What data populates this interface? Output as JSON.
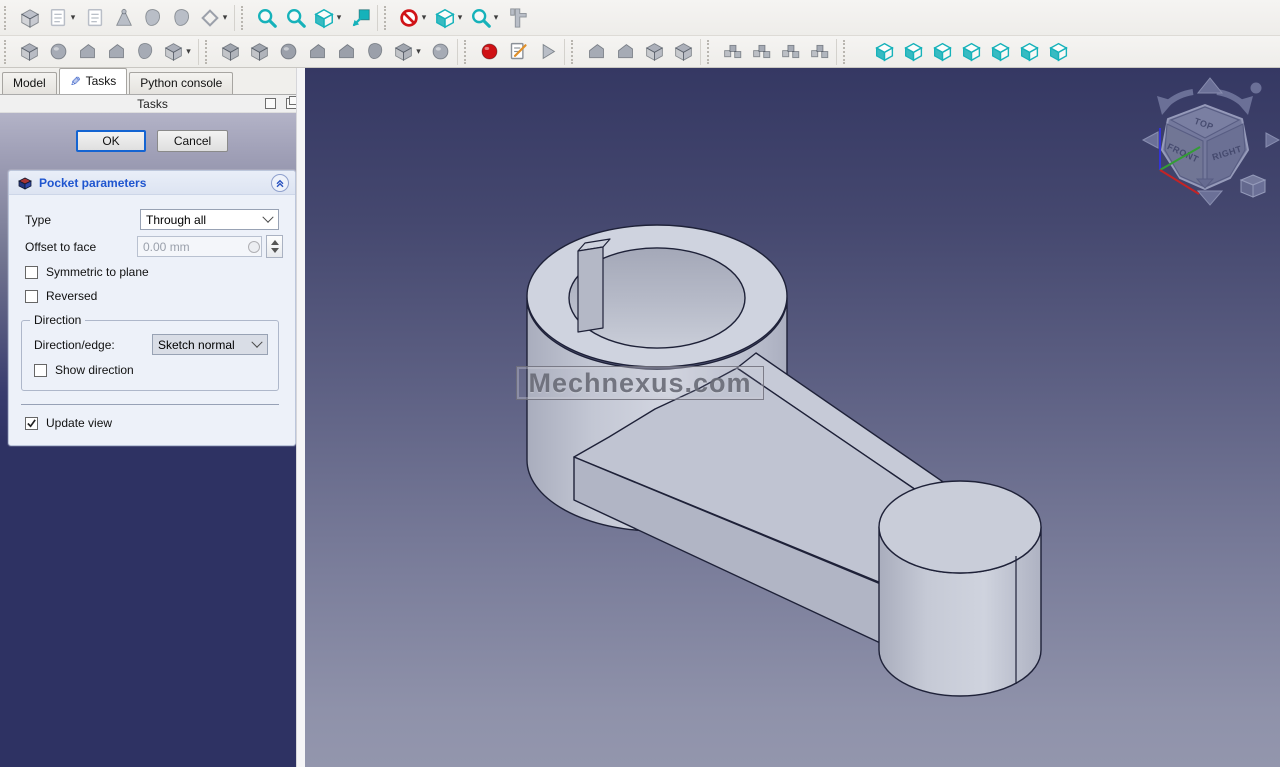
{
  "tabs": {
    "model": "Model",
    "tasks": "Tasks",
    "python": "Python console"
  },
  "tasks_header": {
    "title": "Tasks"
  },
  "dialog": {
    "ok": "OK",
    "cancel": "Cancel"
  },
  "pocket": {
    "title": "Pocket parameters",
    "type_label": "Type",
    "type_value": "Through all",
    "offset_label": "Offset to face",
    "offset_value": "0.00 mm",
    "symmetric_label": "Symmetric to plane",
    "reversed_label": "Reversed",
    "direction": {
      "legend": "Direction",
      "edge_label": "Direction/edge:",
      "edge_value": "Sketch normal",
      "show_label": "Show direction"
    },
    "update_view": "Update view"
  },
  "viewport": {
    "watermark": "Mechnexus.com",
    "navcube": {
      "top": "TOP",
      "front": "FRONT",
      "right": "RIGHT"
    }
  },
  "colors": {
    "teal": "#16b2ba",
    "red": "#d01317",
    "gray_icon": "#a6abb5",
    "light_gray_icon": "#b9bec7",
    "ok_border": "#1464d2",
    "panel_dark": "#2e3263",
    "title_blue": "#1f55cf"
  },
  "toolbars": {
    "row1": [
      {
        "items": [
          {
            "name": "create-body",
            "sym": "cube",
            "color": "#b9bec7",
            "disabled": true
          },
          {
            "name": "create-sketch",
            "sym": "doc",
            "color": "#b9bec7",
            "disabled": true,
            "dropdown": true
          },
          {
            "name": "edit-sketch",
            "sym": "doc",
            "color": "#b9bec7",
            "disabled": true
          },
          {
            "name": "map-sketch-to-face",
            "sym": "cone",
            "color": "#b9bec7",
            "disabled": true
          },
          {
            "name": "create-shapebinder",
            "sym": "blob",
            "color": "#b9bec7",
            "disabled": true
          },
          {
            "name": "create-clone",
            "sym": "blob",
            "color": "#b9bec7",
            "disabled": true
          },
          {
            "name": "create-datum",
            "sym": "diamond",
            "color": "#9ba0aa",
            "disabled": true,
            "dropdown": true
          }
        ]
      },
      {
        "items": [
          {
            "name": "zoom-fit-all",
            "sym": "magnifier",
            "color": "#16b2ba"
          },
          {
            "name": "zoom-selection",
            "sym": "magnifier",
            "color": "#16b2ba"
          },
          {
            "name": "view-axonometric",
            "sym": "cubeview",
            "color": "#16b2ba",
            "dropdown": true
          },
          {
            "name": "fit-selection",
            "sym": "arrowsq",
            "color": "#16b2ba"
          }
        ]
      },
      {
        "items": [
          {
            "name": "stop-operation",
            "sym": "nosign",
            "color": "#d01317",
            "dropdown": true
          },
          {
            "name": "box-element-selection",
            "sym": "cubeview",
            "color": "#16b2ba",
            "dropdown": true
          },
          {
            "name": "refresh-view",
            "sym": "magnifier",
            "color": "#16b2ba",
            "dropdown": true
          },
          {
            "name": "measure",
            "sym": "caliper",
            "color": "#b9bec7",
            "disabled": true
          }
        ]
      }
    ],
    "row2": [
      {
        "items": [
          {
            "name": "pad",
            "sym": "cube",
            "color": "#a6abb5"
          },
          {
            "name": "revolution",
            "sym": "sphere",
            "color": "#a6abb5"
          },
          {
            "name": "additive-loft",
            "sym": "wedge",
            "color": "#a6abb5"
          },
          {
            "name": "additive-sweep",
            "sym": "wedge",
            "color": "#a6abb5"
          },
          {
            "name": "additive-helix",
            "sym": "blob",
            "color": "#a6abb5"
          },
          {
            "name": "additive-primitive",
            "sym": "cube",
            "color": "#a6abb5",
            "dropdown": true
          }
        ]
      },
      {
        "items": [
          {
            "name": "pocket",
            "sym": "cube",
            "color": "#9ba0aa"
          },
          {
            "name": "hole",
            "sym": "cube",
            "color": "#9ba0aa"
          },
          {
            "name": "groove",
            "sym": "sphere",
            "color": "#9ba0aa"
          },
          {
            "name": "subtractive-loft",
            "sym": "wedge",
            "color": "#9ba0aa"
          },
          {
            "name": "subtractive-sweep",
            "sym": "wedge",
            "color": "#9ba0aa"
          },
          {
            "name": "subtractive-helix",
            "sym": "blob",
            "color": "#9ba0aa"
          },
          {
            "name": "subtractive-primitive",
            "sym": "cube",
            "color": "#9ba0aa",
            "dropdown": true
          },
          {
            "name": "boolean-operation",
            "sym": "sphere",
            "color": "#a6abb5"
          }
        ]
      },
      {
        "items": [
          {
            "name": "macro-record",
            "sym": "record",
            "color": "#cf1115"
          },
          {
            "name": "macro-edit",
            "sym": "docpencil",
            "color": "#8a9097"
          },
          {
            "name": "macro-execute",
            "sym": "play",
            "color": "#b9bec7"
          }
        ]
      },
      {
        "items": [
          {
            "name": "fillet",
            "sym": "wedge",
            "color": "#a6abb5"
          },
          {
            "name": "chamfer",
            "sym": "wedge",
            "color": "#a6abb5"
          },
          {
            "name": "draft",
            "sym": "cube",
            "color": "#a6abb5"
          },
          {
            "name": "thickness",
            "sym": "cube",
            "color": "#a6abb5"
          }
        ]
      },
      {
        "items": [
          {
            "name": "mirrored",
            "sym": "pattern",
            "color": "#a6abb5"
          },
          {
            "name": "linear-pattern",
            "sym": "pattern",
            "color": "#a6abb5"
          },
          {
            "name": "polar-pattern",
            "sym": "pattern",
            "color": "#a6abb5"
          },
          {
            "name": "create-multitransform",
            "sym": "pattern",
            "color": "#a6abb5"
          }
        ]
      },
      {
        "items": [
          {
            "name": "view-isometric",
            "sym": "cubeview",
            "color": "#16b2ba"
          },
          {
            "name": "view-front",
            "sym": "cubeview",
            "color": "#16b2ba"
          },
          {
            "name": "view-top",
            "sym": "cubeview",
            "color": "#16b2ba"
          },
          {
            "name": "view-right",
            "sym": "cubeview",
            "color": "#16b2ba"
          },
          {
            "name": "view-rear",
            "sym": "cubeview",
            "color": "#16b2ba"
          },
          {
            "name": "view-bottom",
            "sym": "cubeview",
            "color": "#16b2ba"
          },
          {
            "name": "view-left",
            "sym": "cubeview",
            "color": "#16b2ba"
          }
        ]
      }
    ]
  }
}
